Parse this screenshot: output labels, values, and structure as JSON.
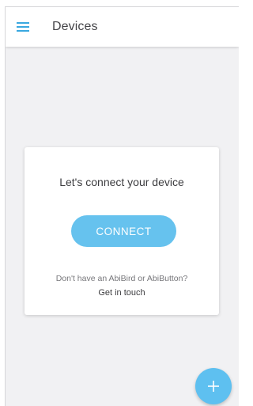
{
  "app_bar": {
    "title": "Devices",
    "menu_icon": "hamburger-menu-icon"
  },
  "connect_card": {
    "heading": "Let's connect your device",
    "connect_button_label": "CONNECT",
    "help_text": "Don't have an AbiBird or AbiButton?",
    "help_link": "Get in touch"
  },
  "fab": {
    "icon": "plus-icon",
    "label": "+"
  },
  "colors": {
    "accent": "#5ec0f0",
    "button": "#66c2ee",
    "background": "#f1f1f3",
    "card": "#ffffff",
    "menu_icon": "#3aa8e0"
  }
}
